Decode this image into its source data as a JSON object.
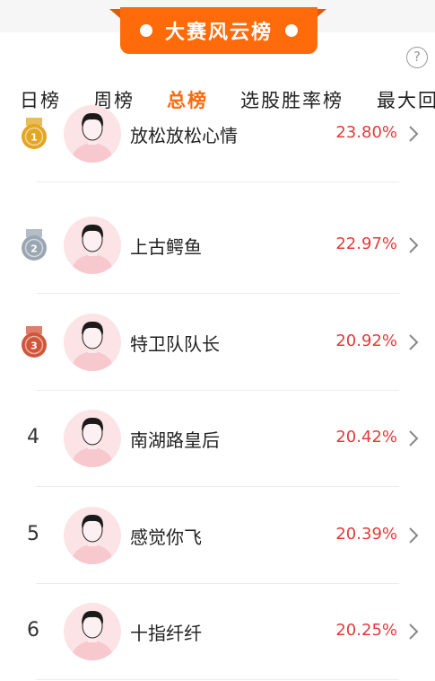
{
  "banner": {
    "title": "大赛风云榜"
  },
  "tabs": [
    {
      "label": "日榜",
      "active": false
    },
    {
      "label": "周榜",
      "active": false
    },
    {
      "label": "总榜",
      "active": true
    },
    {
      "label": "选股胜率榜",
      "active": false
    },
    {
      "label": "最大回",
      "active": false
    }
  ],
  "help": {
    "icon": "question-icon",
    "symbol": "?"
  },
  "rows": [
    {
      "rank": "1",
      "medal": "gold",
      "name": "放松放松心情",
      "rate": "23.80%"
    },
    {
      "rank": "2",
      "medal": "silver",
      "name": "上古鳄鱼",
      "rate": "22.97%"
    },
    {
      "rank": "3",
      "medal": "bronze",
      "name": "特卫队队长",
      "rate": "20.92%"
    },
    {
      "rank": "4",
      "medal": "",
      "name": "南湖路皇后",
      "rate": "20.42%"
    },
    {
      "rank": "5",
      "medal": "",
      "name": "感觉你飞",
      "rate": "20.39%"
    },
    {
      "rank": "6",
      "medal": "",
      "name": "十指纤纤",
      "rate": "20.25%"
    }
  ],
  "colors": {
    "accent": "#ff6a0a",
    "rate": "#e23b3b",
    "gold": "#e2a524",
    "silver": "#9aa7b3",
    "bronze": "#d0563a"
  }
}
